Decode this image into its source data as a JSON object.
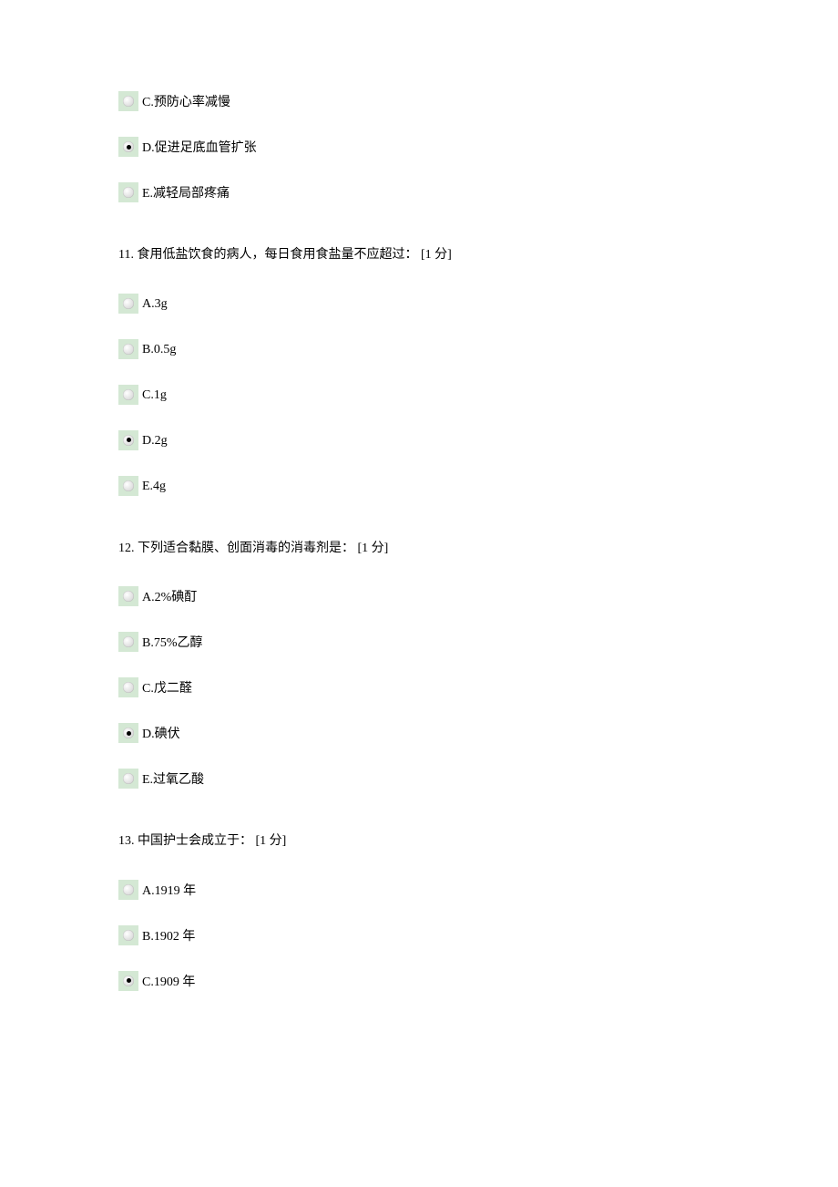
{
  "q10_partial": {
    "options": [
      {
        "label": "C.预防心率减慢",
        "selected": false
      },
      {
        "label": "D.促进足底血管扩张",
        "selected": true
      },
      {
        "label": "E.减轻局部疼痛",
        "selected": false
      }
    ]
  },
  "q11": {
    "text": "11. 食用低盐饮食的病人，每日食用食盐量不应超过： [1 分]",
    "options": [
      {
        "label": "A.3g",
        "selected": false
      },
      {
        "label": "B.0.5g",
        "selected": false
      },
      {
        "label": "C.1g",
        "selected": false
      },
      {
        "label": "D.2g",
        "selected": true
      },
      {
        "label": "E.4g",
        "selected": false
      }
    ]
  },
  "q12": {
    "text": "12. 下列适合黏膜、创面消毒的消毒剂是： [1 分]",
    "options": [
      {
        "label": "A.2%碘酊",
        "selected": false
      },
      {
        "label": "B.75%乙醇",
        "selected": false
      },
      {
        "label": "C.戊二醛",
        "selected": false
      },
      {
        "label": "D.碘伏",
        "selected": true
      },
      {
        "label": "E.过氧乙酸",
        "selected": false
      }
    ]
  },
  "q13": {
    "text": "13. 中国护士会成立于： [1 分]",
    "options": [
      {
        "label": "A.1919 年",
        "selected": false
      },
      {
        "label": "B.1902 年",
        "selected": false
      },
      {
        "label": "C.1909 年",
        "selected": true
      }
    ]
  }
}
